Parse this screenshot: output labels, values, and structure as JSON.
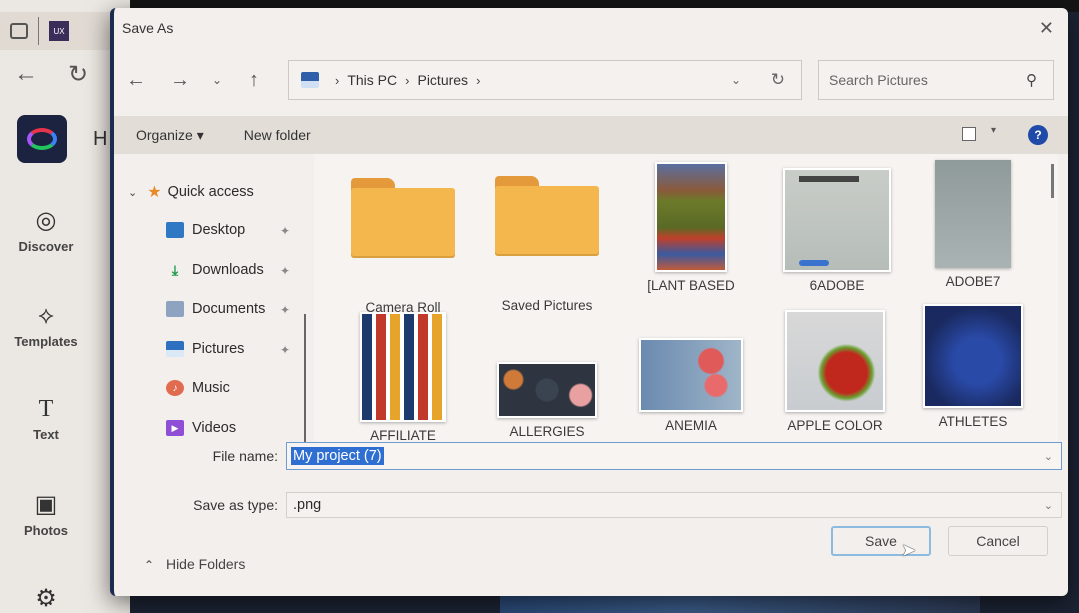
{
  "background_app": {
    "tab_logo_text": "UX",
    "home_initial": "H",
    "rail": [
      {
        "label": "Discover",
        "icon": "compass-icon",
        "glyph": "◎"
      },
      {
        "label": "Templates",
        "icon": "templates-icon",
        "glyph": "⟡"
      },
      {
        "label": "Text",
        "icon": "text-icon",
        "glyph": "T"
      },
      {
        "label": "Photos",
        "icon": "photos-icon",
        "glyph": "▣"
      },
      {
        "label": "",
        "icon": "settings-gear-icon",
        "glyph": "⚙"
      }
    ],
    "nav": {
      "back": "←",
      "reload": "↻"
    }
  },
  "dialog": {
    "title": "Save As",
    "close": "✕",
    "nav": {
      "back": "←",
      "forward": "→",
      "recent": "⌄",
      "up": "↑"
    },
    "address": {
      "crumbs": [
        "This PC",
        "Pictures"
      ],
      "separator": "›",
      "dropdown": "⌄",
      "refresh": "↻"
    },
    "search": {
      "placeholder": "Search Pictures",
      "icon": "⚲"
    },
    "toolbar": {
      "organize": "Organize ▾",
      "new_folder": "New folder",
      "view_drop": "▾",
      "help": "?"
    },
    "nav_pane": {
      "quick_access": {
        "label": "Quick access",
        "expand": "⌄",
        "icon": "★"
      },
      "items": [
        {
          "label": "Desktop",
          "pinned": true
        },
        {
          "label": "Downloads",
          "pinned": true
        },
        {
          "label": "Documents",
          "pinned": true
        },
        {
          "label": "Pictures",
          "pinned": true
        },
        {
          "label": "Music",
          "pinned": false
        },
        {
          "label": "Videos",
          "pinned": false
        }
      ],
      "pin_glyph": "📌"
    },
    "files": [
      {
        "name": "Camera Roll",
        "type": "folder"
      },
      {
        "name": "Saved Pictures",
        "type": "folder"
      },
      {
        "name": "[LANT BASED",
        "type": "image"
      },
      {
        "name": "6ADOBE",
        "type": "image"
      },
      {
        "name": "ADOBE7",
        "type": "image"
      },
      {
        "name": "AFFILIATE",
        "type": "image"
      },
      {
        "name": "ALLERGIES",
        "type": "image"
      },
      {
        "name": "ANEMIA",
        "type": "image"
      },
      {
        "name": "APPLE COLOR",
        "type": "image"
      },
      {
        "name": "ATHLETES",
        "type": "image"
      }
    ],
    "file_name": {
      "label": "File name:",
      "value": "My project (7)"
    },
    "save_as_type": {
      "label": "Save as type:",
      "value": ".png"
    },
    "hide_folders": "Hide Folders",
    "hide_folders_icon": "⌃",
    "save_button": "Save",
    "cancel_button": "Cancel",
    "chevron": "⌄"
  }
}
